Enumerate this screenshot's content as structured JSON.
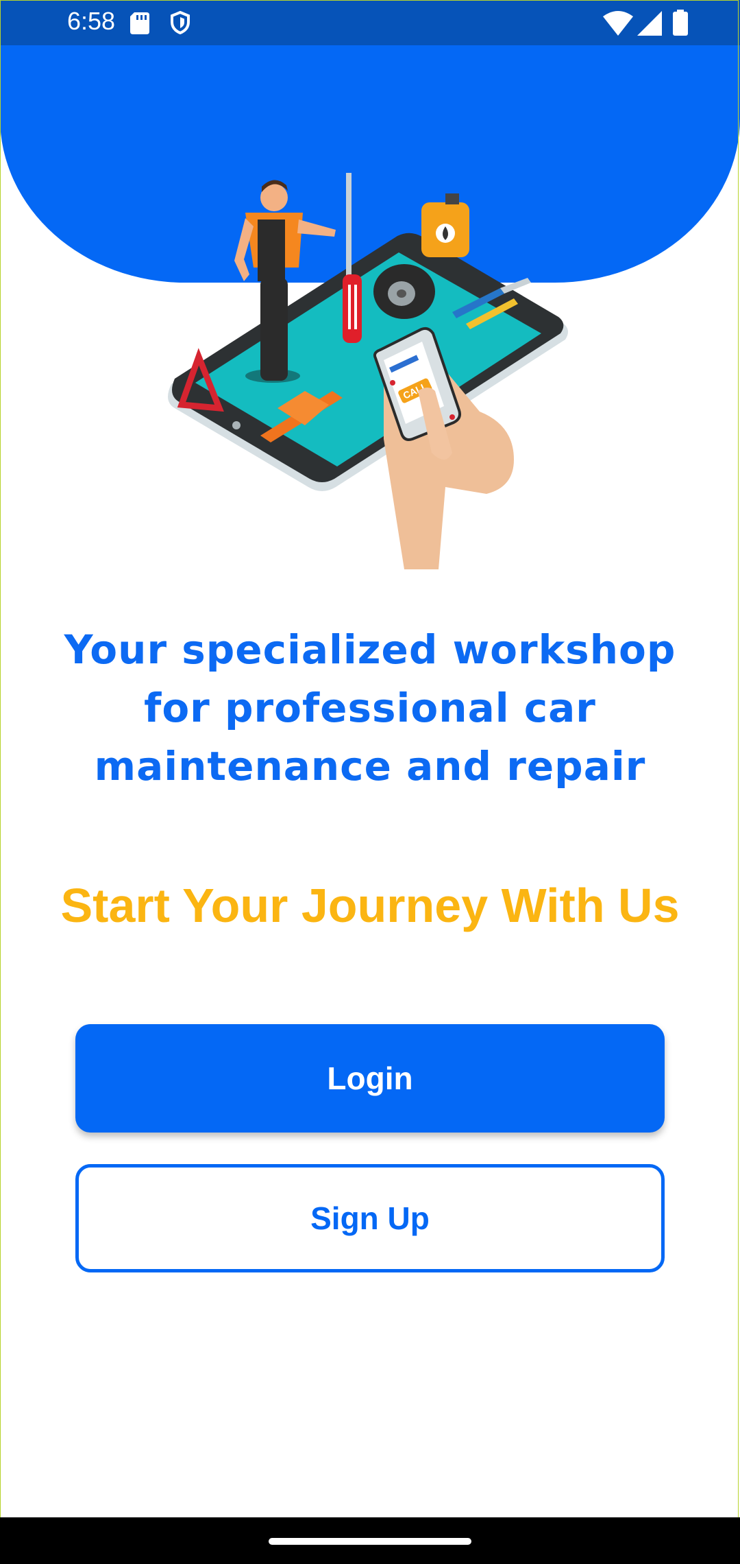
{
  "status_bar": {
    "time": "6:58",
    "icons": [
      "sd-card-icon",
      "shield-icon",
      "wifi-icon",
      "cell-signal-icon",
      "battery-icon"
    ]
  },
  "hero": {
    "illustration": "mechanic-phone-illustration",
    "illustration_text": "CALL",
    "background_color": "#0468f5"
  },
  "tagline": {
    "line1": "Your specialized workshop",
    "line2": "for professional car",
    "line3": "maintenance and repair"
  },
  "subtitle": "Start Your Journey With Us",
  "buttons": {
    "login": "Login",
    "signup": "Sign Up"
  },
  "colors": {
    "primary": "#0468f5",
    "accent": "#fbb512",
    "status_bar": "#0653b8"
  }
}
